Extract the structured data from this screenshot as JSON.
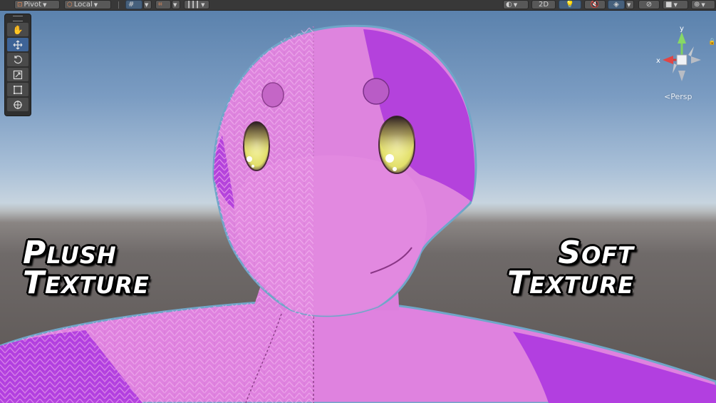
{
  "toolbar": {
    "pivot_label": "Pivot",
    "local_label": "Local",
    "mode_2d_label": "2D"
  },
  "tools": [
    {
      "name": "hand-tool",
      "icon": "hand-icon"
    },
    {
      "name": "move-tool",
      "icon": "move-arrows-icon",
      "active": true
    },
    {
      "name": "rotate-tool",
      "icon": "rotate-icon"
    },
    {
      "name": "scale-tool",
      "icon": "scale-icon"
    },
    {
      "name": "rect-tool",
      "icon": "rect-icon"
    },
    {
      "name": "transform-tool",
      "icon": "transform-icon"
    }
  ],
  "gizmo": {
    "x_label": "x",
    "y_label": "y",
    "projection_label": "Persp"
  },
  "overlay": {
    "left_line1_first": "P",
    "left_line1_rest": "LUSH",
    "left_line2_first": "T",
    "left_line2_rest": "EXTURE",
    "right_line1_first": "S",
    "right_line1_rest": "OFT",
    "right_line2_first": "T",
    "right_line2_rest": "EXTURE"
  },
  "colors": {
    "selection_accent": "#3e6396",
    "model_pink": "#df82df",
    "model_purple": "#b23fe0"
  }
}
